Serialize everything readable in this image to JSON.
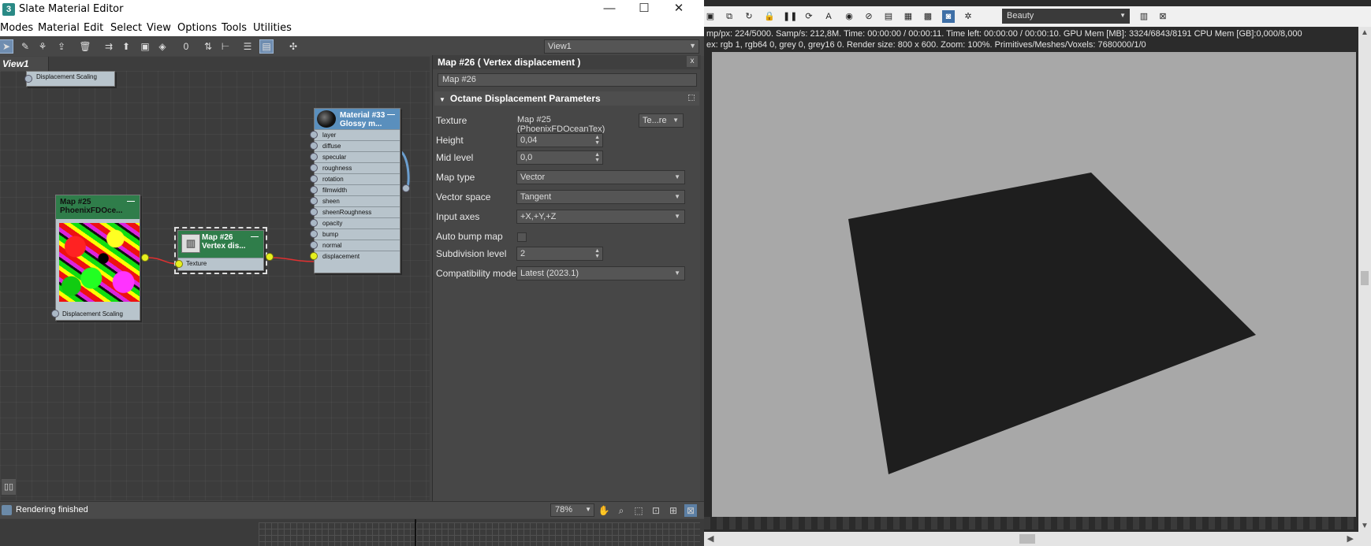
{
  "slate": {
    "title": "Slate Material Editor",
    "window_controls": {
      "minimize": "—",
      "maximize": "☐",
      "close": "✕"
    },
    "menu": [
      "Modes",
      "Material",
      "Edit",
      "Select",
      "View",
      "Options",
      "Tools",
      "Utilities"
    ],
    "view_dropdown": "View1",
    "view_tab": "View1",
    "nodes": {
      "partial_top": {
        "slot": "Displacement Scaling"
      },
      "map25": {
        "title_line1": "Map #25",
        "title_line2": "PhoenixFDOce...",
        "slot": "Displacement Scaling"
      },
      "map26": {
        "title_line1": "Map #26",
        "title_line2": "Vertex dis...",
        "slot": "Texture"
      },
      "material33": {
        "title_line1": "Material #33",
        "title_line2": "Glossy m...",
        "slots": [
          "layer",
          "diffuse",
          "specular",
          "roughness",
          "rotation",
          "filmwidth",
          "sheen",
          "sheenRoughness",
          "opacity",
          "bump",
          "normal",
          "displacement"
        ]
      }
    },
    "status_text": "Rendering finished",
    "zoom_value": "78%",
    "minimize_glyph": "—"
  },
  "panel": {
    "title": "Map #26  ( Vertex displacement )",
    "close_glyph": "x",
    "map_name": "Map #26",
    "rollout_title": "Octane Displacement Parameters",
    "texture": {
      "label": "Texture",
      "value": "Map #25 (PhoenixFDOceanTex)",
      "mode": "Te...re"
    },
    "height": {
      "label": "Height",
      "value": "0,04"
    },
    "mid_level": {
      "label": "Mid level",
      "value": "0,0"
    },
    "map_type": {
      "label": "Map type",
      "value": "Vector"
    },
    "vector_space": {
      "label": "Vector space",
      "value": "Tangent"
    },
    "input_axes": {
      "label": "Input axes",
      "value": "+X,+Y,+Z"
    },
    "auto_bump": {
      "label": "Auto bump map",
      "checked": false
    },
    "subdivision": {
      "label": "Subdivision level",
      "value": "2"
    },
    "compat": {
      "label": "Compatibility mode",
      "value": "Latest (2023.1)"
    }
  },
  "render": {
    "pass_dropdown": "Beauty",
    "stats_line1": "mp/px: 224/5000.   Samp/s: 212,8M.   Time: 00:00:00 / 00:00:11.   Time left: 00:00:00 / 00:00:10.   GPU Mem [MB]: 3324/6843/8191   CPU Mem [GB]:0,000/8,000",
    "stats_line2": "ex: rgb 1, rgb64 0, grey 0, grey16 0.   Render size: 800 x 600.   Zoom: 100%.   Primitives/Meshes/Voxels: 7680000/1/0",
    "background_color": "#a8a8a8",
    "plane_color": "#1e1e1e"
  }
}
